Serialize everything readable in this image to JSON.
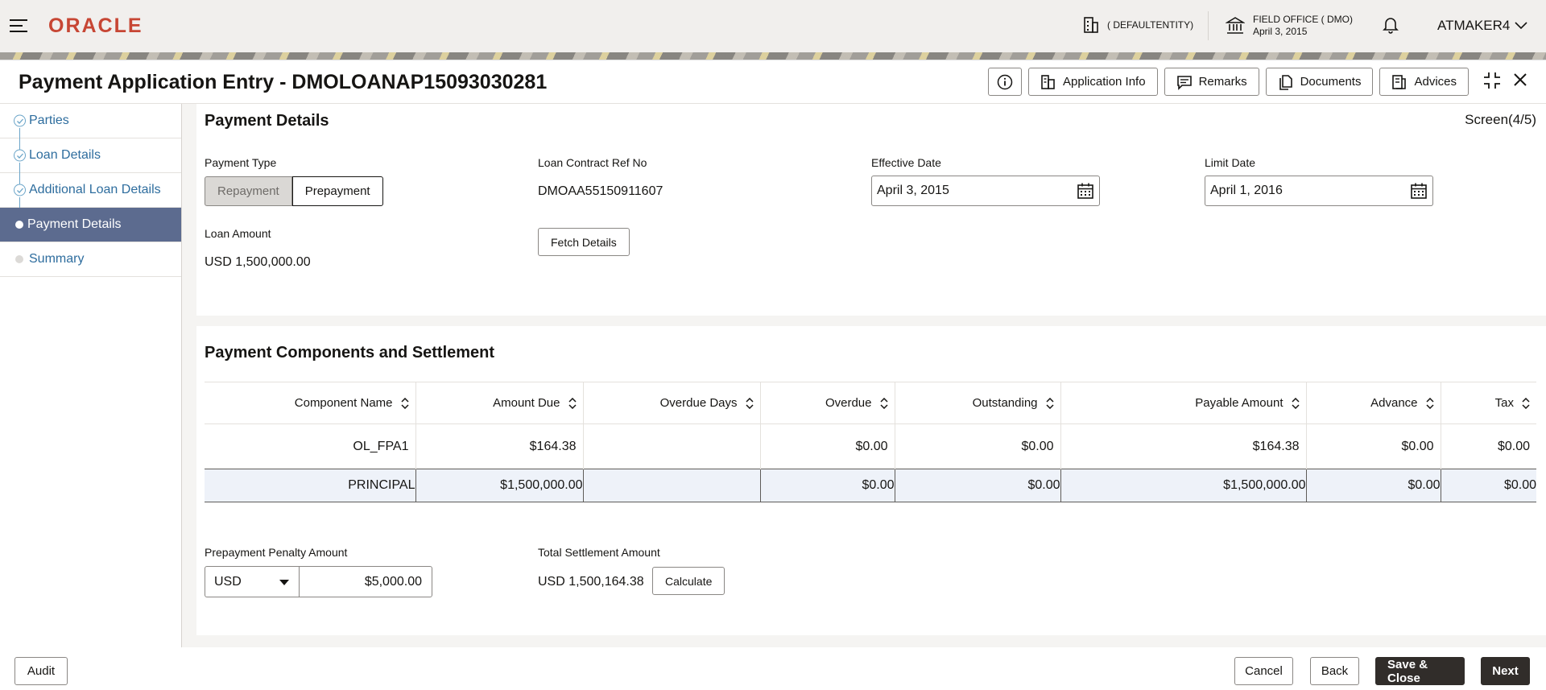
{
  "app": {
    "logo": "ORACLE"
  },
  "topbar": {
    "entity": "( DEFAULTENTITY)",
    "office_name": "FIELD OFFICE ( DMO)",
    "office_date": "April 3, 2015",
    "user": "ATMAKER4"
  },
  "header": {
    "title": "Payment Application Entry - DMOLOANAP15093030281",
    "buttons": {
      "application_info": "Application Info",
      "remarks": "Remarks",
      "documents": "Documents",
      "advices": "Advices"
    }
  },
  "sidebar": {
    "items": [
      {
        "label": "Parties",
        "state": "done"
      },
      {
        "label": "Loan Details",
        "state": "done"
      },
      {
        "label": "Additional Loan Details",
        "state": "done"
      },
      {
        "label": "Payment Details",
        "state": "active"
      },
      {
        "label": "Summary",
        "state": "pending"
      }
    ]
  },
  "payment_details": {
    "title": "Payment Details",
    "screen": "Screen(4/5)",
    "payment_type_label": "Payment Type",
    "payment_type_options": [
      "Repayment",
      "Prepayment"
    ],
    "loan_ref_label": "Loan Contract Ref No",
    "loan_ref_value": "DMOAA55150911607",
    "effective_date_label": "Effective Date",
    "effective_date_value": "April 3, 2015",
    "limit_date_label": "Limit Date",
    "limit_date_value": "April 1, 2016",
    "loan_amount_label": "Loan Amount",
    "loan_amount_value": "USD 1,500,000.00",
    "fetch_button": "Fetch Details"
  },
  "components": {
    "title": "Payment Components and Settlement",
    "columns": [
      "Component Name",
      "Amount Due",
      "Overdue Days",
      "Overdue",
      "Outstanding",
      "Payable Amount",
      "Advance",
      "Tax"
    ],
    "rows": [
      [
        "OL_FPA1",
        "$164.38",
        "",
        "$0.00",
        "$0.00",
        "$164.38",
        "$0.00",
        "$0.00"
      ],
      [
        "PRINCIPAL",
        "$1,500,000.00",
        "",
        "$0.00",
        "$0.00",
        "$1,500,000.00",
        "$0.00",
        "$0.00"
      ]
    ],
    "penalty_label": "Prepayment Penalty Amount",
    "penalty_currency": "USD",
    "penalty_amount": "$5,000.00",
    "total_label": "Total Settlement Amount",
    "total_value": "USD 1,500,164.38",
    "calculate_button": "Calculate"
  },
  "footer": {
    "audit": "Audit",
    "cancel": "Cancel",
    "back": "Back",
    "save_close": "Save & Close",
    "next": "Next"
  },
  "colors": {
    "brand": "#c74634",
    "active_nav": "#5c6b8f",
    "link": "#2e6d9e",
    "primary_button": "#312d2a"
  }
}
